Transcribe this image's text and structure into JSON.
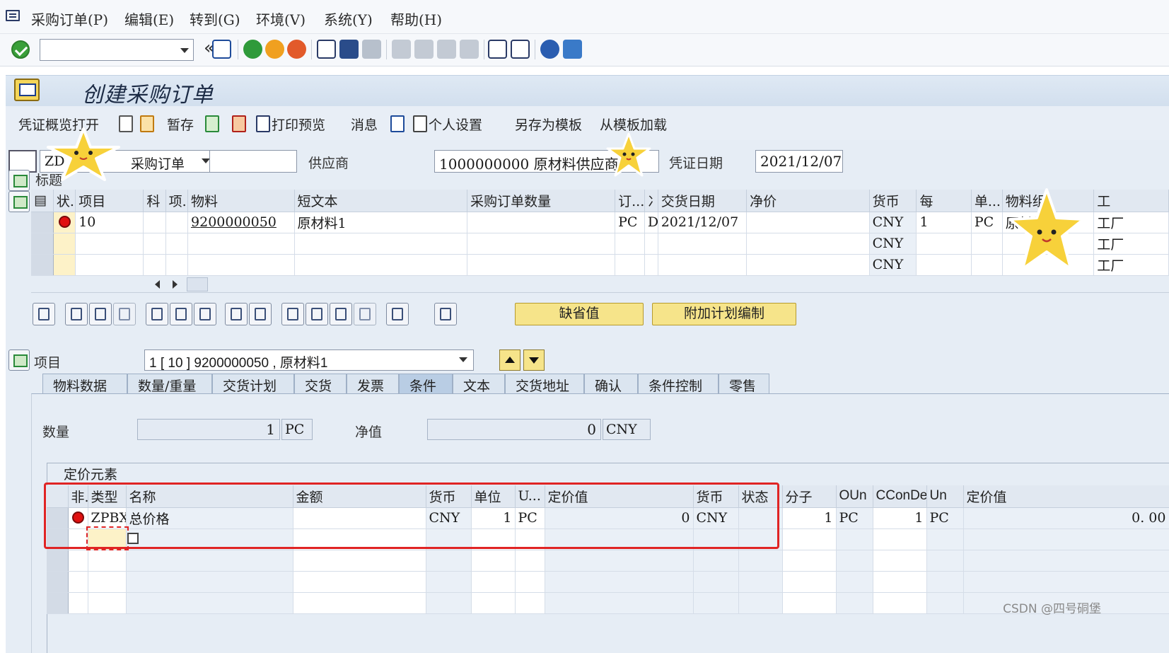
{
  "menubar": {
    "items": [
      "采购订单(P)",
      "编辑(E)",
      "转到(G)",
      "环境(V)",
      "系统(Y)",
      "帮助(H)"
    ]
  },
  "toolbar": {
    "command_value": "",
    "collapse_symbol": "«"
  },
  "title": {
    "text": "创建采购订单"
  },
  "app_toolbar": {
    "doc_overview": "凭证概览打开",
    "hold": "暂存",
    "print_preview": "打印预览",
    "messages": "消息",
    "personal_settings": "个人设置",
    "save_as_template": "另存为模板",
    "load_from_template": "从模板加载"
  },
  "header": {
    "doc_type_code": "ZD",
    "doc_type_name": "采购订单",
    "doc_number": "",
    "vendor_label": "供应商",
    "vendor_value": "1000000000 原材料供应商1",
    "doc_date_label": "凭证日期",
    "doc_date_value": "2021/12/07",
    "header_label": "标题"
  },
  "items_table": {
    "columns": [
      "状.",
      "项目",
      "科",
      "项.",
      "物料",
      "短文本",
      "采购订单数量",
      "订...",
      "冫",
      "交货日期",
      "净价",
      "货币",
      "每",
      "单...",
      "物料组",
      "工"
    ],
    "rows": [
      {
        "item": "10",
        "material": "9200000050",
        "short_text": "原材料1",
        "qty": "",
        "unit": "PC",
        "d": "D",
        "delivery_date": "2021/12/07",
        "net_price": "",
        "currency": "CNY",
        "per": "1",
        "order_unit": "PC",
        "mat_group": "原材料-czc",
        "plant": "工厂"
      },
      {
        "item": "",
        "material": "",
        "short_text": "",
        "qty": "",
        "unit": "",
        "d": "",
        "delivery_date": "",
        "net_price": "",
        "currency": "CNY",
        "per": "",
        "order_unit": "",
        "mat_group": "",
        "plant": "工厂"
      },
      {
        "item": "",
        "material": "",
        "short_text": "",
        "qty": "",
        "unit": "",
        "d": "",
        "delivery_date": "",
        "net_price": "",
        "currency": "CNY",
        "per": "",
        "order_unit": "",
        "mat_group": "",
        "plant": "工厂"
      }
    ]
  },
  "table_buttons": {
    "default_values": "缺省值",
    "additional_planning": "附加计划编制"
  },
  "item_detail": {
    "label": "项目",
    "selected": "1 [ 10 ] 9200000050 , 原材料1",
    "tabs": [
      "物料数据",
      "数量/重量",
      "交货计划",
      "交货",
      "发票",
      "条件",
      "文本",
      "交货地址",
      "确认",
      "条件控制",
      "零售"
    ],
    "active_tab": "条件",
    "quantity_label": "数量",
    "quantity_value": "1",
    "quantity_unit": "PC",
    "net_value_label": "净值",
    "net_value_value": "0",
    "net_value_currency": "CNY"
  },
  "pricing": {
    "title": "定价元素",
    "columns": [
      "非.",
      "类型",
      "名称",
      "金额",
      "货币",
      "单位",
      "U...",
      "定价值",
      "货币",
      "状态",
      "分子",
      "OUn",
      "CConDe",
      "Un",
      "定价值"
    ],
    "rows": [
      {
        "type": "ZPBX",
        "name": "总价格",
        "amount": "",
        "currency": "CNY",
        "unit": "1",
        "uom": "PC",
        "cond_value": "0",
        "cond_currency": "CNY",
        "status": "",
        "numerator": "1",
        "oun": "PC",
        "cconde": "1",
        "un": "PC",
        "cond_value2": "0. 00"
      }
    ]
  },
  "watermark": "CSDN @四号硐堡",
  "colors": {
    "title_bar": "#d2dfee",
    "panel_bg": "#e6edf5",
    "highlight_box": "#e02424",
    "yellow_button": "#f6e48a",
    "status_error": "#e01010"
  },
  "icons": [
    "system-menu-icon",
    "enter-check-icon",
    "save-icon",
    "back-icon",
    "exit-icon",
    "cancel-icon",
    "print-icon",
    "find-icon",
    "find-next-icon",
    "first-page-icon",
    "prev-page-icon",
    "next-page-icon",
    "last-page-icon",
    "new-session-icon",
    "shortcut-icon",
    "help-icon",
    "layout-icon",
    "cart-icon",
    "star-sticker"
  ]
}
